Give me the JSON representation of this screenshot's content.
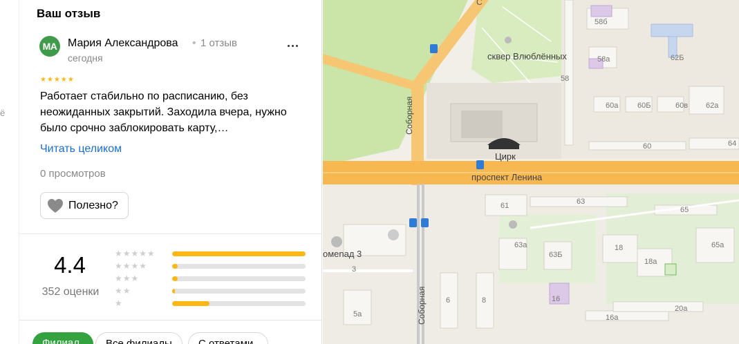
{
  "edge": {
    "text": "ё"
  },
  "panel": {
    "title": "Ваш отзыв",
    "review": {
      "avatar_initials": "МА",
      "avatar_color": "#3f9a4a",
      "author": "Мария Александрова",
      "separator": "•",
      "author_reviews": "1 отзыв",
      "date": "сегодня",
      "stars": "★★★★★",
      "rating": 5,
      "text": "Работает стабильно по расписанию, без неожиданных закрытий. Заходила вчера, нужно было срочно заблокировать карту,…",
      "read_more": "Читать целиком",
      "views": "0 просмотров",
      "helpful_label": "Полезно?"
    },
    "summary": {
      "rating": "4.4",
      "count": "352 оценки",
      "bars": [
        {
          "stars": "★★★★★",
          "share": 1.0
        },
        {
          "stars": "★★★★",
          "share": 0.04
        },
        {
          "stars": "★★★",
          "share": 0.04
        },
        {
          "stars": "★★",
          "share": 0.02
        },
        {
          "stars": "★",
          "share": 0.28
        }
      ]
    },
    "filters": {
      "branch": "Филиал",
      "all_branches": "Все филиалы",
      "with_answers": "С ответами"
    }
  },
  "map": {
    "labels": {
      "road_top": "С",
      "square": "сквер Влюблённых",
      "circus": "Цирк",
      "avenue": "проспект Ленина",
      "sobornaya_upper": "Соборная",
      "sobornaya_lower": "Соборная",
      "promenade": "омenад 3"
    },
    "houses": {
      "h58b": "58б",
      "h58a": "58а",
      "h62b": "62Б",
      "h58": "58",
      "h60a": "60а",
      "h60b": "60Б",
      "h60v": "60в",
      "h62a": "62а",
      "h60": "60",
      "h64": "64",
      "h61": "61",
      "h63": "63",
      "h65": "65",
      "h63a": "63а",
      "h63b": "63Б",
      "h18": "18",
      "h18a": "18а",
      "h65a": "65а",
      "h3": "3",
      "h6": "6",
      "h8": "8",
      "h16": "16",
      "h5a": "5а",
      "h16a": "16а",
      "h20a": "20а"
    }
  }
}
